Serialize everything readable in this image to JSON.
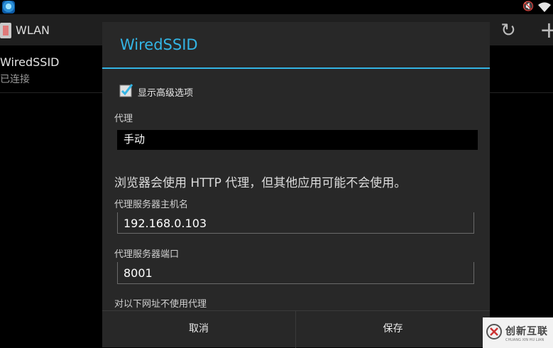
{
  "action_bar": {
    "title": "WLAN"
  },
  "network": {
    "name": "WiredSSID",
    "status": "已连接"
  },
  "dialog": {
    "title": "WiredSSID",
    "advanced_label": "显示高级选项",
    "advanced_checked": true,
    "proxy_label": "代理",
    "proxy_value": "手动",
    "warning": "浏览器会使用 HTTP 代理，但其他应用可能不会使用。",
    "host_label": "代理服务器主机名",
    "host_value": "192.168.0.103",
    "port_label": "代理服务器端口",
    "port_value": "8001",
    "bypass_label": "对以下网址不使用代理",
    "cancel_label": "取消",
    "save_label": "保存"
  },
  "watermark": {
    "text": "创新互联",
    "subtext": "CHUANG XIN HU LIAN"
  },
  "colors": {
    "accent": "#33b5e5",
    "dialog_bg": "#282828",
    "background": "#000000"
  }
}
